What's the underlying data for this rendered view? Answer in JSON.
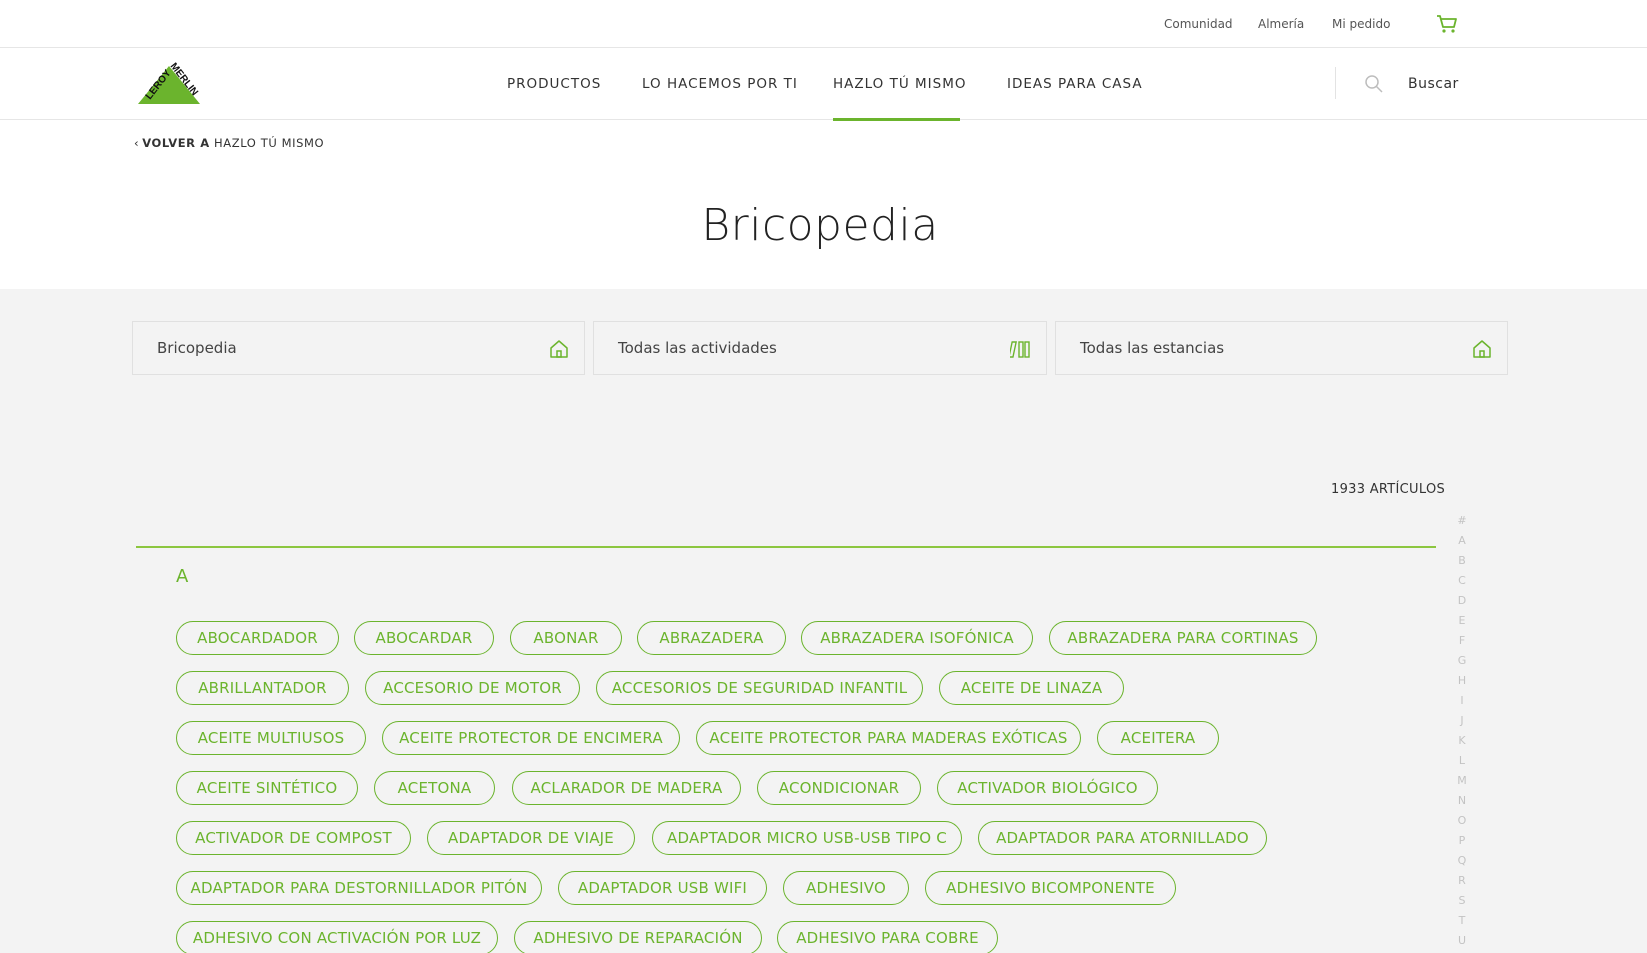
{
  "topbar": {
    "links": [
      "Comunidad",
      "Almería",
      "Mi pedido"
    ]
  },
  "nav": {
    "logo_text": "LEROY MERLIN",
    "items": [
      "PRODUCTOS",
      "LO HACEMOS POR TI",
      "HAZLO TÚ MISMO",
      "IDEAS PARA CASA"
    ],
    "active_item": "HAZLO TÚ MISMO",
    "search_label": "Buscar"
  },
  "back": {
    "prefix": "VOLVER A",
    "target": "HAZLO TÚ MISMO"
  },
  "page_title": "Bricopedia",
  "filters": [
    {
      "label": "Bricopedia",
      "icon": "house-icon"
    },
    {
      "label": "Todas las actividades",
      "icon": "tools-icon"
    },
    {
      "label": "Todas las estancias",
      "icon": "house-icon"
    }
  ],
  "article_count": "1933 ARTÍCULOS",
  "current_letter": "A",
  "alphabet": [
    "#",
    "A",
    "B",
    "C",
    "D",
    "E",
    "F",
    "G",
    "H",
    "I",
    "J",
    "K",
    "L",
    "M",
    "N",
    "O",
    "P",
    "Q",
    "R",
    "S",
    "T",
    "U"
  ],
  "tags": [
    "ABOCARDADOR",
    "ABOCARDAR",
    "ABONAR",
    "ABRAZADERA",
    "ABRAZADERA ISOFÓNICA",
    "ABRAZADERA PARA CORTINAS",
    "ABRILLANTADOR",
    "ACCESORIO DE MOTOR",
    "ACCESORIOS DE SEGURIDAD INFANTIL",
    "ACEITE DE LINAZA",
    "ACEITE MULTIUSOS",
    "ACEITE PROTECTOR DE ENCIMERA",
    "ACEITE PROTECTOR PARA MADERAS EXÓTICAS",
    "ACEITERA",
    "ACEITE SINTÉTICO",
    "ACETONA",
    "ACLARADOR DE MADERA",
    "ACONDICIONAR",
    "ACTIVADOR BIOLÓGICO",
    "ACTIVADOR DE COMPOST",
    "ADAPTADOR DE VIAJE",
    "ADAPTADOR MICRO USB-USB TIPO C",
    "ADAPTADOR PARA ATORNILLADO",
    "ADAPTADOR PARA DESTORNILLADOR PITÓN",
    "ADAPTADOR USB WIFI",
    "ADHESIVO",
    "ADHESIVO BICOMPONENTE",
    "ADHESIVO CON ACTIVACIÓN POR LUZ",
    "ADHESIVO DE REPARACIÓN",
    "ADHESIVO PARA COBRE"
  ],
  "colors": {
    "brand_green": "#6bb42d",
    "grey_bg": "#f3f3f3"
  }
}
